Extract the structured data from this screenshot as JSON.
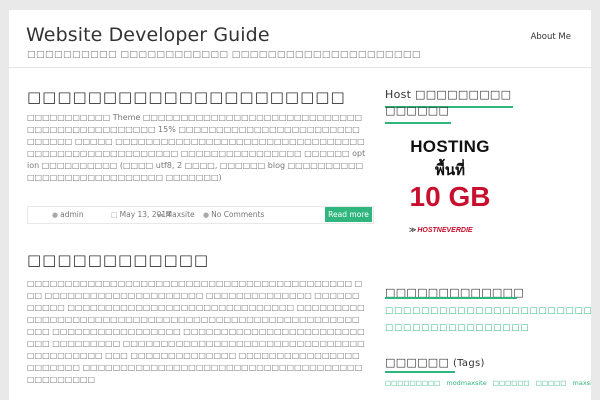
{
  "header": {
    "site_title": "Website Developer Guide",
    "tagline": "□□□□□□□□□□ □□□□□□□□□□□□ □□□□□□□□□□□□□□□□□□□□□",
    "nav_about": "About Me"
  },
  "posts": [
    {
      "title": "□□□□□□□□□□□□□□□□□□□□□□□□",
      "excerpt": "□□□□□□□□□□□ Theme □□□□□□□□□□□□□□□□□□□□□□□□□□□□□□□□□□□□□□□□□□□□□□ 15% □□□□□□□□□□□□□□□□□□□□□□□□□□□□□□ □□□□□ □□□□□□□□□□□□□□□□□□□□□□□□□□□□□□□□□□□□□□□□□□□□□□□□□□□□□ □□□□□□□□□□□□□□□□ □□□□□□ option □□□□□□□□□□ (□□□□ utf8, 2 □□□□, □□□□□□ blog □□□□□□□□□□□□□□□□□□□□□□□□□□□□ □□□□□□□)",
      "meta": {
        "author": "admin",
        "date": "May 13, 2014",
        "category": "Maxsite",
        "comments": "No Comments"
      },
      "read_more": "Read more"
    },
    {
      "title": "□□□□□□□□□□□□",
      "excerpt": "□□□□□□□□□□□□□□□□□□□□□□□□□□□□□□□□□□□□□□□□□□□ □□□ □□□□□□□□□□□□□□□□□□□□□ □□□□□□□□□□□□□□ □□□□□□□□□□□ □□□□□□□□□□□□□□□□□□□□□□□□□□□□□□ □□□□□□□□□ □□□□□□□□□□□□□□□□□□□□□□□□□□□□□□□□□□□□□□□□□□□□□□□ □□□□□□□□□□□□□□□□□ □□□□□□□□□□□□□□□□□□□□□□□□□□□ □□□□□□□□□ □□□□□□□□□□□□□□□□□□□□□□□□□□□□□□□□□□□□□□□□□□ □□□ □□□□□□□□□□□□□□ □□□□□□□□□□□□□□□□□□□□□□□ □□□□□□□□□□□□□□□□□□□□□□□□□□□□□□□□□□□□□□□□□□□□□□"
    }
  ],
  "sidebar": {
    "host_widget_title": "Host □□□□□□□□□",
    "host_widget_title_line2": "□□□□□□",
    "ad": {
      "line1": "HOSTING",
      "line2": "พื้นที่",
      "line3": "10 GB",
      "logo": "HOSTNEVERDIE"
    },
    "recent_title": "□□□□□□□□□□□□□",
    "recent_links": [
      "□□□□□□□□□□□□□□□□□□□□□□□□□□",
      "□□□□□□□□□□□□□□□□"
    ],
    "tags_title": "□□□□□□",
    "tags_title_paren": "(Tags)",
    "tags": [
      "□□□□□□□□□",
      "modmaxsite",
      "□□□□□□",
      "□□□□□",
      "maxsite"
    ]
  },
  "colors": {
    "accent": "#2fb67e",
    "ad_red": "#c8102e",
    "page_bg": "#e9e9e9"
  }
}
